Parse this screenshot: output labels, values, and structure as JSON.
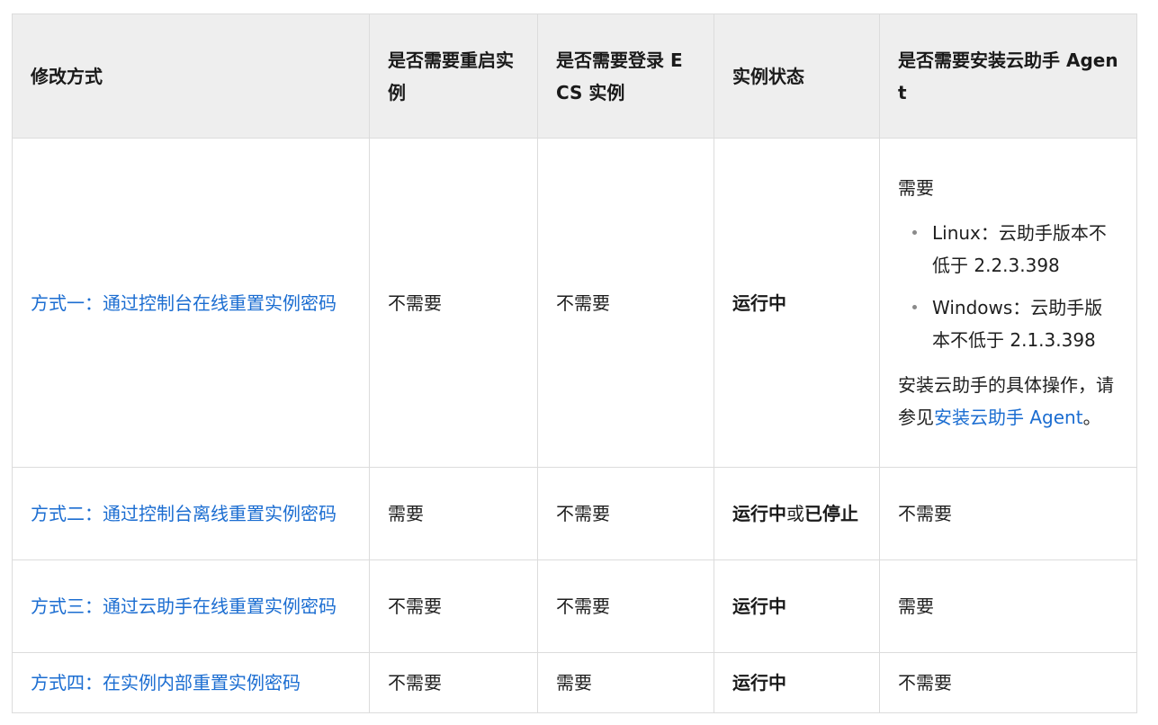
{
  "headers": {
    "method": "修改方式",
    "restart": "是否需要重启实例",
    "login": "是否需要登录 ECS 实例",
    "state": "实例状态",
    "agent": "是否需要安装云助手 Agent"
  },
  "rows": [
    {
      "method": "方式一：通过控制台在线重置实例密码",
      "restart": "不需要",
      "login": "不需要",
      "state": "运行中",
      "agent": {
        "intro": "需要",
        "bullets": [
          "Linux：云助手版本不低于 2.2.3.398",
          "Windows：云助手版本不低于 2.1.3.398"
        ],
        "note_prefix": "安装云助手的具体操作，请参见",
        "note_link": "安装云助手 Agent",
        "note_suffix": "。"
      }
    },
    {
      "method": "方式二：通过控制台离线重置实例密码",
      "restart": "需要",
      "login": "不需要",
      "state_a": "运行中",
      "state_or": "或",
      "state_b": "已停止",
      "agent": "不需要"
    },
    {
      "method": "方式三：通过云助手在线重置实例密码",
      "restart": "不需要",
      "login": "不需要",
      "state": "运行中",
      "agent": "需要"
    },
    {
      "method": "方式四：在实例内部重置实例密码",
      "restart": "不需要",
      "login": "需要",
      "state": "运行中",
      "agent": "不需要"
    }
  ]
}
